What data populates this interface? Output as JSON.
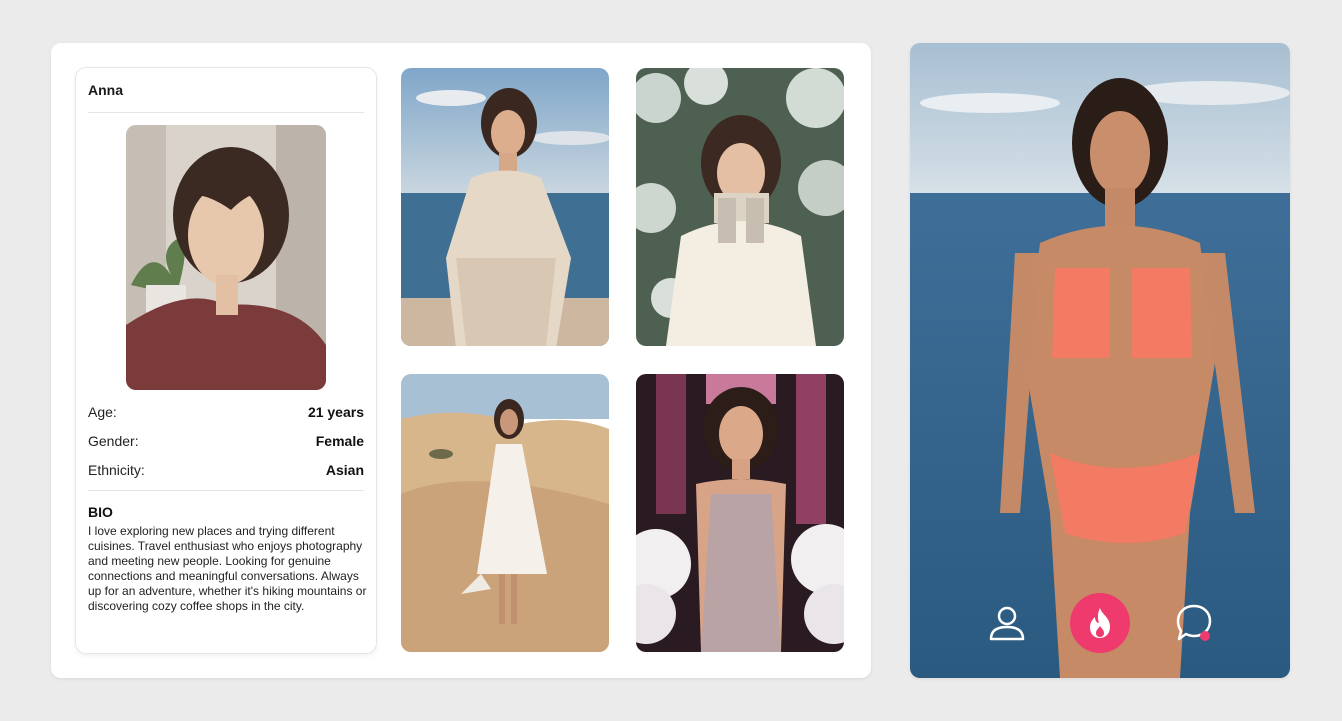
{
  "profile": {
    "name": "Anna",
    "fields": [
      {
        "label": "Age:",
        "value": "21 years"
      },
      {
        "label": "Gender:",
        "value": "Female"
      },
      {
        "label": "Ethnicity:",
        "value": "Asian"
      }
    ],
    "bio_title": "BIO",
    "bio_text": "I love exploring new places and trying different cuisines. Travel enthusiast who enjoys photography and meeting new people. Looking for genuine connections and meaningful conversations. Always up for an adventure, whether it's hiking mountains or discovering cozy coffee shops in the city."
  },
  "gallery": [
    {
      "scene": "beach-shawl"
    },
    {
      "scene": "snowy-tree-fleece"
    },
    {
      "scene": "desert-white-dress"
    },
    {
      "scene": "sequin-dress-feathers"
    }
  ],
  "main_photo": {
    "scene": "ocean-coral-bikini"
  },
  "nav": {
    "items": [
      {
        "icon": "user-icon"
      },
      {
        "icon": "flame-icon",
        "active": true
      },
      {
        "icon": "chat-bubble-icon",
        "notification": true
      }
    ],
    "accent_color": "#ef3a6e"
  }
}
